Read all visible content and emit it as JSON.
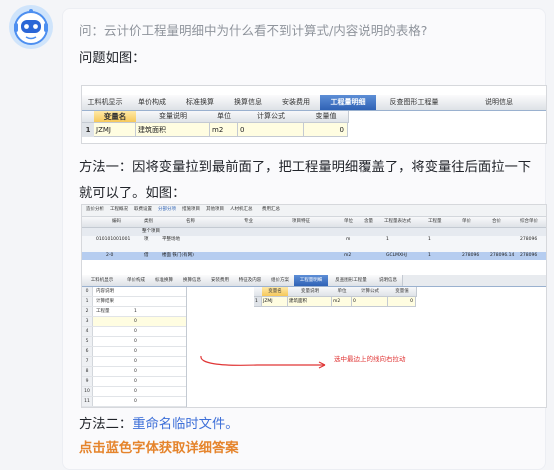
{
  "question": "问：云计价工程量明细中为什么看不到计算式/内容说明的表格?",
  "lines": {
    "problem": "问题如图：",
    "method1": "方法一：因将变量拉到最前面了，把工程量明细覆盖了，将变量往后面拉一下就可以了。如图：",
    "method2_prefix": "方法二：",
    "method2_link": "重命名临时文件。",
    "cta": "点击蓝色字体获取详细答案"
  },
  "screenshot1": {
    "tabs": [
      "工料机显示",
      "单价构成",
      "标准换算",
      "换算信息",
      "安装费用",
      "工程量明细",
      "反查图形工程量",
      "说明信息"
    ],
    "active_tab": "工程量明细",
    "headers": [
      "变量名",
      "变量说明",
      "单位",
      "计算公式",
      "变量值"
    ],
    "row": {
      "no": "1",
      "name": "JZMJ",
      "desc": "建筑面积",
      "unit": "m2",
      "formula": "0",
      "value": "0"
    }
  },
  "screenshot2": {
    "toolbar": [
      "造价分析",
      "工程概况",
      "取费设置",
      "分部分项",
      "措施项目",
      "其他项目",
      "人材机汇总",
      "费用汇总"
    ],
    "toolbar_active": "分部分项",
    "headers": [
      "编码",
      "类别",
      "名称",
      "专业",
      "项目特征",
      "单位",
      "含量",
      "工程量表达式",
      "工程量",
      "单价",
      "合价",
      "综合单价"
    ],
    "rows": [
      {
        "code": "",
        "type": "",
        "name": "整个项目",
        "unit": "",
        "qty_expr": "",
        "qty": "",
        "price": "",
        "total": "",
        "unit_price": ""
      },
      {
        "code": "010101001001",
        "type": "项",
        "name": "平整场地",
        "unit": "m",
        "qty_expr": "1",
        "qty": "1",
        "price": "",
        "total": "",
        "unit_price": "278096"
      },
      {
        "code": "2-0",
        "type": "借",
        "name": "楼面 铁门(有网)",
        "unit": "m2",
        "qty_expr": "GCLMXHJ",
        "qty": "1",
        "price": "278096",
        "total": "278096.14",
        "unit_price": "278096"
      }
    ],
    "tabs": [
      "工料机显示",
      "单价构成",
      "标准换算",
      "换算信息",
      "安装费用",
      "特征及内容",
      "组价方案",
      "工程量明细",
      "反查图形工程量",
      "说明信息"
    ],
    "active_tab": "工程量明细",
    "left_rows": [
      {
        "no": "0",
        "text": "内容说明",
        "value": ""
      },
      {
        "no": "1",
        "text": "计算结果",
        "value": ""
      },
      {
        "no": "2",
        "text": "工程量",
        "value": "1"
      },
      {
        "no": "3",
        "text": "",
        "value": "0"
      },
      {
        "no": "4",
        "text": "",
        "value": "0"
      },
      {
        "no": "5",
        "text": "",
        "value": "0"
      },
      {
        "no": "6",
        "text": "",
        "value": "0"
      },
      {
        "no": "7",
        "text": "",
        "value": "0"
      },
      {
        "no": "8",
        "text": "",
        "value": "0"
      },
      {
        "no": "9",
        "text": "",
        "value": "0"
      },
      {
        "no": "10",
        "text": "",
        "value": "0"
      },
      {
        "no": "11",
        "text": "",
        "value": "0"
      }
    ],
    "var_headers": [
      "变量名",
      "变量说明",
      "单位",
      "计算公式",
      "变量值"
    ],
    "var_row": {
      "no": "1",
      "name": "JZMJ",
      "desc": "建筑面积",
      "unit": "m2",
      "formula": "0",
      "value": "0"
    },
    "annotation": "选中最边上的线向右拉动"
  },
  "colors": {
    "link": "#3d6fd8",
    "cta": "#e5842c",
    "active_tab": "#2f62b5",
    "highlight": "#f6c85a",
    "annotation": "#e03535"
  }
}
